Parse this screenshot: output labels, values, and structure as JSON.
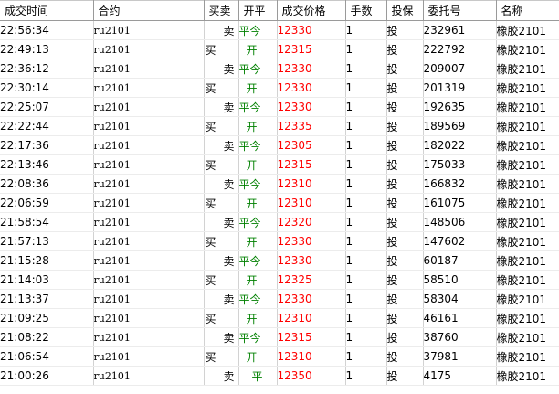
{
  "columns": [
    "成交时间",
    "合约",
    "买卖",
    "开平",
    "成交价格",
    "手数",
    "投保",
    "委托号",
    "名称"
  ],
  "colors": {
    "open_close": "#008000",
    "price": "#ff0000"
  },
  "rows": [
    {
      "time": "22:56:34",
      "contract": "ru2101",
      "side": "卖",
      "oc": "平今",
      "price": "12330",
      "qty": "1",
      "hedge": "投",
      "order": "232961",
      "name": "橡胶2101"
    },
    {
      "time": "22:49:13",
      "contract": "ru2101",
      "side": "买",
      "oc": "开",
      "price": "12315",
      "qty": "1",
      "hedge": "投",
      "order": "222792",
      "name": "橡胶2101"
    },
    {
      "time": "22:36:12",
      "contract": "ru2101",
      "side": "卖",
      "oc": "平今",
      "price": "12330",
      "qty": "1",
      "hedge": "投",
      "order": "209007",
      "name": "橡胶2101"
    },
    {
      "time": "22:30:14",
      "contract": "ru2101",
      "side": "买",
      "oc": "开",
      "price": "12330",
      "qty": "1",
      "hedge": "投",
      "order": "201319",
      "name": "橡胶2101"
    },
    {
      "time": "22:25:07",
      "contract": "ru2101",
      "side": "卖",
      "oc": "平今",
      "price": "12330",
      "qty": "1",
      "hedge": "投",
      "order": "192635",
      "name": "橡胶2101"
    },
    {
      "time": "22:22:44",
      "contract": "ru2101",
      "side": "买",
      "oc": "开",
      "price": "12335",
      "qty": "1",
      "hedge": "投",
      "order": "189569",
      "name": "橡胶2101"
    },
    {
      "time": "22:17:36",
      "contract": "ru2101",
      "side": "卖",
      "oc": "平今",
      "price": "12305",
      "qty": "1",
      "hedge": "投",
      "order": "182022",
      "name": "橡胶2101"
    },
    {
      "time": "22:13:46",
      "contract": "ru2101",
      "side": "买",
      "oc": "开",
      "price": "12315",
      "qty": "1",
      "hedge": "投",
      "order": "175033",
      "name": "橡胶2101"
    },
    {
      "time": "22:08:36",
      "contract": "ru2101",
      "side": "卖",
      "oc": "平今",
      "price": "12310",
      "qty": "1",
      "hedge": "投",
      "order": "166832",
      "name": "橡胶2101"
    },
    {
      "time": "22:06:59",
      "contract": "ru2101",
      "side": "买",
      "oc": "开",
      "price": "12310",
      "qty": "1",
      "hedge": "投",
      "order": "161075",
      "name": "橡胶2101"
    },
    {
      "time": "21:58:54",
      "contract": "ru2101",
      "side": "卖",
      "oc": "平今",
      "price": "12320",
      "qty": "1",
      "hedge": "投",
      "order": "148506",
      "name": "橡胶2101"
    },
    {
      "time": "21:57:13",
      "contract": "ru2101",
      "side": "买",
      "oc": "开",
      "price": "12330",
      "qty": "1",
      "hedge": "投",
      "order": "147602",
      "name": "橡胶2101"
    },
    {
      "time": "21:15:28",
      "contract": "ru2101",
      "side": "卖",
      "oc": "平今",
      "price": "12330",
      "qty": "1",
      "hedge": "投",
      "order": "60187",
      "name": "橡胶2101"
    },
    {
      "time": "21:14:03",
      "contract": "ru2101",
      "side": "买",
      "oc": "开",
      "price": "12325",
      "qty": "1",
      "hedge": "投",
      "order": "58510",
      "name": "橡胶2101"
    },
    {
      "time": "21:13:37",
      "contract": "ru2101",
      "side": "卖",
      "oc": "平今",
      "price": "12330",
      "qty": "1",
      "hedge": "投",
      "order": "58304",
      "name": "橡胶2101"
    },
    {
      "time": "21:09:25",
      "contract": "ru2101",
      "side": "买",
      "oc": "开",
      "price": "12310",
      "qty": "1",
      "hedge": "投",
      "order": "46161",
      "name": "橡胶2101"
    },
    {
      "time": "21:08:22",
      "contract": "ru2101",
      "side": "卖",
      "oc": "平今",
      "price": "12315",
      "qty": "1",
      "hedge": "投",
      "order": "38760",
      "name": "橡胶2101"
    },
    {
      "time": "21:06:54",
      "contract": "ru2101",
      "side": "买",
      "oc": "开",
      "price": "12310",
      "qty": "1",
      "hedge": "投",
      "order": "37981",
      "name": "橡胶2101"
    },
    {
      "time": "21:00:26",
      "contract": "ru2101",
      "side": "卖",
      "oc": "平",
      "price": "12350",
      "qty": "1",
      "hedge": "投",
      "order": "4175",
      "name": "橡胶2101"
    }
  ]
}
